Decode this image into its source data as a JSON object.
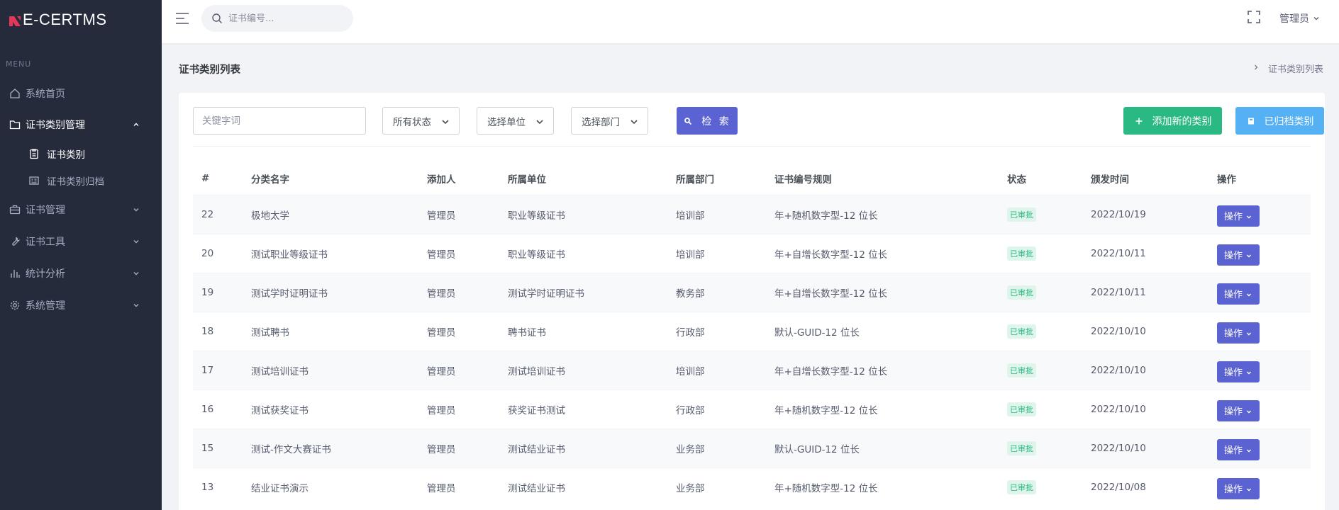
{
  "brand": {
    "name": "E-CERTMS"
  },
  "sidebar": {
    "menu_title": "MENU",
    "items": [
      {
        "label": "系统首页",
        "icon": "home-icon"
      },
      {
        "label": "证书类别管理",
        "icon": "folder-icon",
        "expanded": true
      },
      {
        "label": "证书管理",
        "icon": "briefcase-icon"
      },
      {
        "label": "证书工具",
        "icon": "tools-icon"
      },
      {
        "label": "统计分析",
        "icon": "bar-chart-icon"
      },
      {
        "label": "系统管理",
        "icon": "gear-icon"
      }
    ],
    "sub_items": [
      {
        "label": "证书类别",
        "icon": "clipboard-icon",
        "active": true
      },
      {
        "label": "证书类别归档",
        "icon": "archive-list-icon"
      }
    ]
  },
  "header": {
    "search_placeholder": "证书编号...",
    "user": "管理员"
  },
  "page": {
    "title": "证书类别列表",
    "breadcrumb": "证书类别列表"
  },
  "filters": {
    "keyword_placeholder": "关键字词",
    "status": "所有状态",
    "unit": "选择单位",
    "dept": "选择部门",
    "search_button": "检 索",
    "add_button": "添加新的类别",
    "archived_button": "已归档类别"
  },
  "table": {
    "columns": [
      "#",
      "分类名字",
      "添加人",
      "所属单位",
      "所属部门",
      "证书编号规则",
      "状态",
      "颁发时间",
      "操作"
    ],
    "rows": [
      {
        "id": "22",
        "name": "极地太学",
        "adder": "管理员",
        "unit": "职业等级证书",
        "dept": "培训部",
        "rule": "年+随机数字型-12 位长",
        "status": "已审批",
        "date": "2022/10/19",
        "action": "操作"
      },
      {
        "id": "20",
        "name": "测试职业等级证书",
        "adder": "管理员",
        "unit": "职业等级证书",
        "dept": "培训部",
        "rule": "年+自增长数字型-12 位长",
        "status": "已审批",
        "date": "2022/10/11",
        "action": "操作"
      },
      {
        "id": "19",
        "name": "测试学时证明证书",
        "adder": "管理员",
        "unit": "测试学时证明证书",
        "dept": "教务部",
        "rule": "年+自增长数字型-12 位长",
        "status": "已审批",
        "date": "2022/10/11",
        "action": "操作"
      },
      {
        "id": "18",
        "name": "测试聘书",
        "adder": "管理员",
        "unit": "聘书证书",
        "dept": "行政部",
        "rule": "默认-GUID-12 位长",
        "status": "已审批",
        "date": "2022/10/10",
        "action": "操作"
      },
      {
        "id": "17",
        "name": "测试培训证书",
        "adder": "管理员",
        "unit": "测试培训证书",
        "dept": "培训部",
        "rule": "年+自增长数字型-12 位长",
        "status": "已审批",
        "date": "2022/10/10",
        "action": "操作"
      },
      {
        "id": "16",
        "name": "测试获奖证书",
        "adder": "管理员",
        "unit": "获奖证书测试",
        "dept": "行政部",
        "rule": "年+随机数字型-12 位长",
        "status": "已审批",
        "date": "2022/10/10",
        "action": "操作"
      },
      {
        "id": "15",
        "name": "测试-作文大赛证书",
        "adder": "管理员",
        "unit": "测试结业证书",
        "dept": "业务部",
        "rule": "默认-GUID-12 位长",
        "status": "已审批",
        "date": "2022/10/10",
        "action": "操作"
      },
      {
        "id": "13",
        "name": "结业证书演示",
        "adder": "管理员",
        "unit": "测试结业证书",
        "dept": "业务部",
        "rule": "年+随机数字型-12 位长",
        "status": "已审批",
        "date": "2022/10/08",
        "action": "操作"
      }
    ]
  },
  "colors": {
    "sidebar_bg": "#262b3c",
    "primary": "#5b63d3",
    "success": "#2bb983",
    "info": "#55b1f3",
    "logo": "#e8365a"
  }
}
